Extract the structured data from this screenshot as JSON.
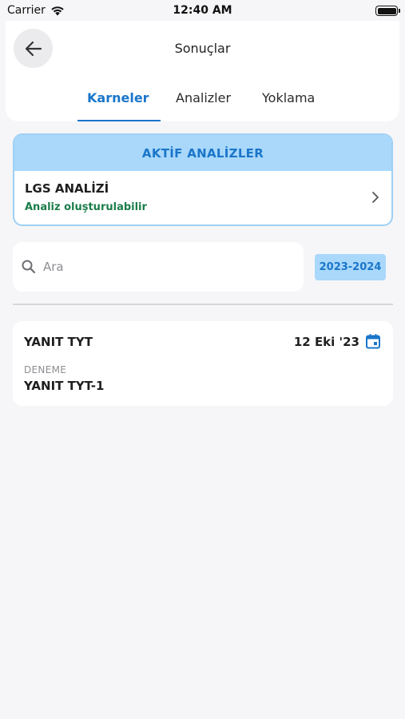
{
  "status_bar": {
    "carrier": "Carrier",
    "time": "12:40 AM"
  },
  "header": {
    "title": "Sonuçlar",
    "tabs": [
      {
        "label": "Karneler",
        "active": true
      },
      {
        "label": "Analizler",
        "active": false
      },
      {
        "label": "Yoklama",
        "active": false
      }
    ]
  },
  "active_analyses": {
    "heading": "AKTİF ANALİZLER",
    "items": [
      {
        "title": "LGS ANALİZİ",
        "subtitle": "Analiz oluşturulabilir"
      }
    ]
  },
  "search": {
    "placeholder": "Ara",
    "value": "",
    "year_filter": "2023-2024"
  },
  "results": [
    {
      "title": "YANIT TYT",
      "date": "12 Eki '23",
      "type": "DENEME",
      "name": "YANIT TYT-1"
    }
  ],
  "colors": {
    "accent": "#1a76c9",
    "accent_light": "#a9d8fb",
    "success": "#1b7d4a",
    "background": "#f6f6f8"
  },
  "icons": [
    "wifi-icon",
    "battery-icon",
    "back-arrow-icon",
    "chevron-right-icon",
    "search-icon",
    "calendar-icon"
  ]
}
